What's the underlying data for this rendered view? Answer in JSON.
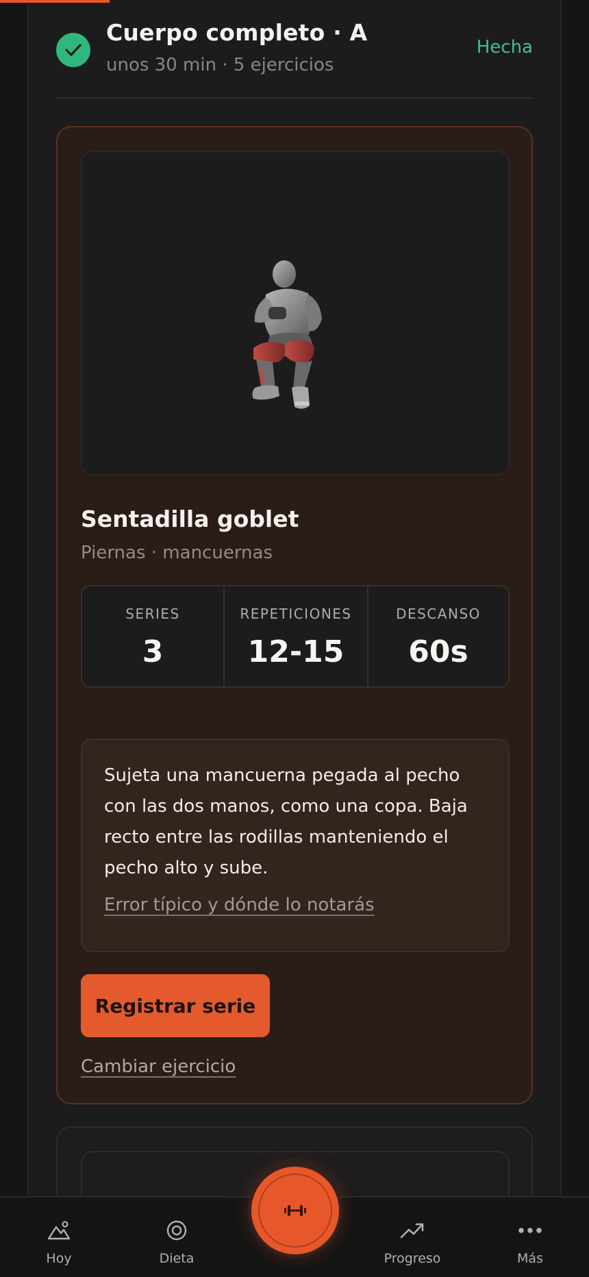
{
  "header": {
    "title": "Cuerpo completo · A",
    "meta": "unos 30 min · 5 ejercicios",
    "status": "Hecha"
  },
  "exercise": {
    "name": "Sentadilla goblet",
    "subtitle": "Piernas · mancuernas",
    "stats": [
      {
        "label": "SERIES",
        "value": "3"
      },
      {
        "label": "REPETICIONES",
        "value": "12-15"
      },
      {
        "label": "DESCANSO",
        "value": "60s"
      }
    ],
    "instructions": "Sujeta una mancuerna pegada al pecho con las dos manos, como una copa. Baja recto entre las rodillas manteniendo el pecho alto y sube.",
    "common_error_link": "Error típico y dónde lo notarás",
    "register_button": "Registrar serie",
    "change_link": "Cambiar ejercicio"
  },
  "nav": {
    "items": [
      {
        "label": "Hoy",
        "icon": "mountain-icon"
      },
      {
        "label": "Dieta",
        "icon": "target-icon"
      },
      {
        "label": "Progreso",
        "icon": "trend-up-icon"
      },
      {
        "label": "Más",
        "icon": "more-dots-icon"
      }
    ],
    "center_icon": "dumbbell-icon"
  },
  "colors": {
    "accent": "#e8572a",
    "success": "#2fb77d",
    "card_bg": "#2a1c17"
  }
}
